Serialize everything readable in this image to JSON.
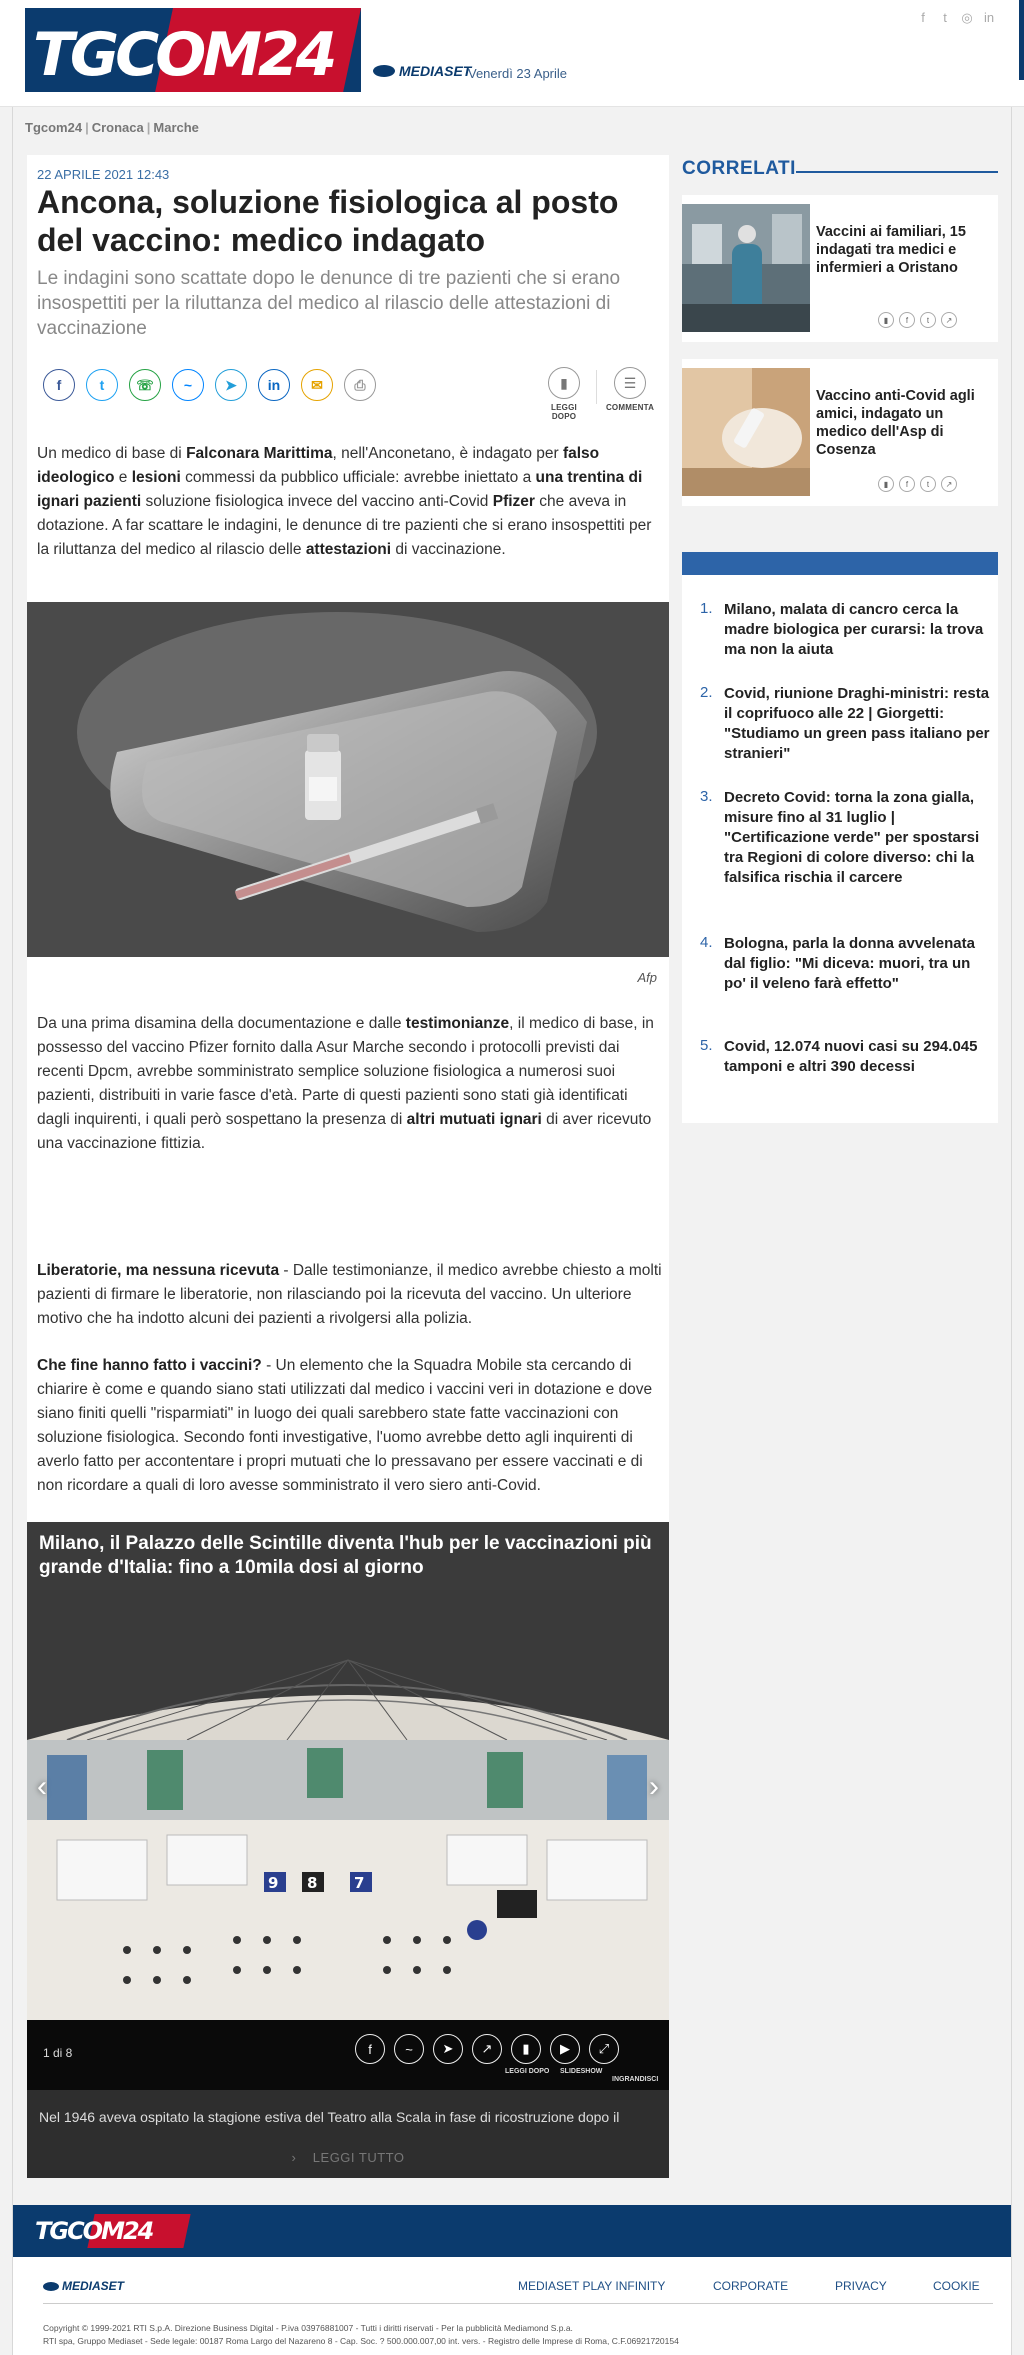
{
  "header": {
    "logo_text": "TGCOM24",
    "mediaset_label": "MEDIASET",
    "date": "Venerdì 23 Aprile",
    "social_icons": [
      "facebook-icon",
      "twitter-icon",
      "instagram-icon",
      "linkedin-icon"
    ]
  },
  "breadcrumb": [
    "Tgcom24",
    "Cronaca",
    "Marche"
  ],
  "article": {
    "date": "22 APRILE 2021 12:43",
    "title": "Ancona, soluzione fisiologica al posto del vaccino: medico indagato",
    "subtitle": "Le indagini sono scattate dopo le denunce di tre pazienti che si erano insospettiti per la riluttanza del medico al rilascio delle attestazioni di vaccinazione",
    "share_icons": [
      "facebook-icon",
      "twitter-icon",
      "whatsapp-icon",
      "messenger-icon",
      "telegram-icon",
      "linkedin-icon",
      "email-icon",
      "print-icon"
    ],
    "read_later_label": "LEGGI DOPO",
    "comment_label": "COMMENTA",
    "image_caption": "Afp",
    "p1": {
      "a": "Un medico di base di ",
      "b": "Falconara Marittima",
      "c": ", nell'Anconetano, è indagato per ",
      "d": "falso ideologico",
      "e": " e ",
      "f": "lesioni",
      "g": " commessi da pubblico ufficiale: avrebbe iniettato a ",
      "h": "una trentina di ignari pazienti",
      "i": " soluzione fisiologica invece del vaccino anti-Covid ",
      "j": "Pfizer",
      "k": " che aveva in dotazione. A far scattare le indagini, le denunce di tre pazienti che si erano insospettiti per la riluttanza del medico al rilascio delle ",
      "l": "attestazioni",
      "m": " di vaccinazione."
    },
    "p2": {
      "a": "Da una prima disamina della documentazione e dalle ",
      "b": "testimonianze",
      "c": ", il medico di base, in possesso del vaccino Pfizer fornito dalla Asur Marche secondo i protocolli previsti dai recenti Dpcm, avrebbe somministrato semplice soluzione fisiologica a numerosi suoi pazienti, distribuiti in varie fasce d'età. Parte di questi pazienti sono stati già identificati dagli inquirenti, i quali però sospettano la presenza di ",
      "d": "altri mutuati ignari",
      "e": " di aver ricevuto una vaccinazione fittizia."
    },
    "p3": {
      "a": "Liberatorie, ma nessuna ricevuta",
      "b": " - Dalle testimonianze, il medico avrebbe chiesto a molti pazienti di firmare le liberatorie, non rilasciando poi la ricevuta del vaccino. Un ulteriore motivo che ha indotto alcuni dei pazienti a rivolgersi alla polizia."
    },
    "p4": {
      "a": "Che fine hanno fatto i vaccini?",
      "b": " - Un elemento che la Squadra Mobile sta cercando di chiarire è come e quando siano stati utilizzati dal medico i vaccini veri in dotazione e dove siano finiti quelli \"risparmiati\" in luogo dei quali sarebbero state fatte vaccinazioni con soluzione fisiologica. Secondo fonti investigative, l'uomo avrebbe detto agli inquirenti di averlo fatto per accontentare i propri mutuati che lo pressavano per essere vaccinati e di non ricordare a quali di loro avesse somministrato il vero siero anti-Covid."
    }
  },
  "gallery": {
    "title": "Milano, il Palazzo delle Scintille diventa l'hub per le vaccinazioni più grande d'Italia: fino a 10mila dosi al giorno",
    "counter": "1 di 8",
    "labels": [
      "LEGGI DOPO",
      "SLIDESHOW",
      "INGRANDISCI"
    ],
    "booth_numbers": [
      "9",
      "8",
      "7"
    ],
    "caption": "Nel 1946 aveva ospitato la stagione estiva del Teatro alla Scala in fase di ricostruzione dopo il",
    "read_all": "LEGGI TUTTO"
  },
  "sidebar": {
    "correlati_title": "CORRELATI",
    "related": [
      {
        "title": "Vaccini ai familiari, 15 indagati tra medici e infermieri a Oristano"
      },
      {
        "title": "Vaccino anti-Covid agli amici, indagato un medico dell'Asp di Cosenza"
      }
    ],
    "top_news": [
      {
        "num": "1.",
        "title": "Milano, malata di cancro cerca la madre biologica per curarsi: la trova ma non la aiuta"
      },
      {
        "num": "2.",
        "title": "Covid, riunione Draghi-ministri: resta il coprifuoco alle 22 | Giorgetti: \"Studiamo un green pass italiano per stranieri\""
      },
      {
        "num": "3.",
        "title": "Decreto Covid: torna la zona gialla, misure fino al 31 luglio | \"Certificazione verde\" per spostarsi tra Regioni di colore diverso: chi la falsifica rischia il carcere"
      },
      {
        "num": "4.",
        "title": "Bologna, parla la donna avvelenata dal figlio: \"Mi diceva: muori, tra un po' il veleno farà effetto\""
      },
      {
        "num": "5.",
        "title": "Covid, 12.074 nuovi casi su 294.045 tamponi e altri 390 decessi"
      }
    ]
  },
  "footer": {
    "logo_text": "TGCOM24",
    "mediaset_label": "MEDIASET",
    "links": [
      "MEDIASET PLAY INFINITY",
      "CORPORATE",
      "PRIVACY",
      "COOKIE"
    ],
    "copyright_1": "Copyright © 1999-2021 RTI S.p.A. Direzione Business Digital - P.iva 03976881007 - Tutti i diritti riservati - Per la pubblicità Mediamond S.p.a.",
    "copyright_2": "RTI spa, Gruppo Mediaset - Sede legale: 00187 Roma Largo del Nazareno 8 - Cap. Soc. ? 500.000.007,00 int. vers. - Registro delle Imprese di Roma, C.F.06921720154"
  },
  "colors": {
    "brand_blue": "#0b3b6e",
    "brand_red": "#c8102e",
    "link_blue": "#2d64a8"
  }
}
